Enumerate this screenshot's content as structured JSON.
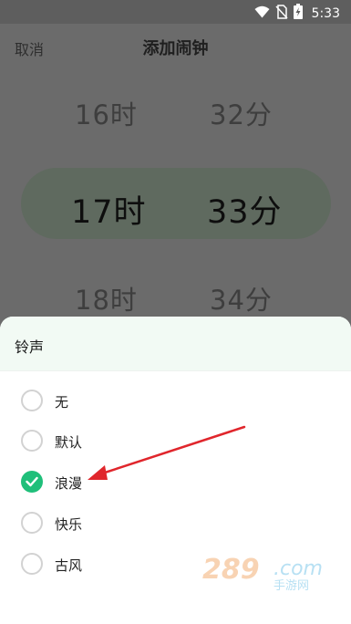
{
  "status_bar": {
    "time": "5:33",
    "icons": [
      "wifi-icon",
      "no-sim-icon",
      "battery-charging-icon"
    ]
  },
  "header": {
    "cancel_label": "取消",
    "title": "添加闹钟"
  },
  "time_picker": {
    "hours": {
      "above": "16时",
      "selected": "17时",
      "below": "18时"
    },
    "minutes": {
      "above": "32分",
      "selected": "33分",
      "below": "34分"
    }
  },
  "ringtone_sheet": {
    "title": "铃声",
    "options": [
      {
        "label": "无",
        "selected": false
      },
      {
        "label": "默认",
        "selected": false
      },
      {
        "label": "浪漫",
        "selected": true
      },
      {
        "label": "快乐",
        "selected": false
      },
      {
        "label": "古风",
        "selected": false
      }
    ]
  },
  "colors": {
    "accent_green": "#1fbf7a",
    "annotation_red": "#e0262c",
    "sheet_header_bg": "#f2faf4"
  },
  "annotation": {
    "icon": "red-arrow-icon"
  },
  "watermark": {
    "text": "289.com",
    "subtext": "手游网"
  }
}
